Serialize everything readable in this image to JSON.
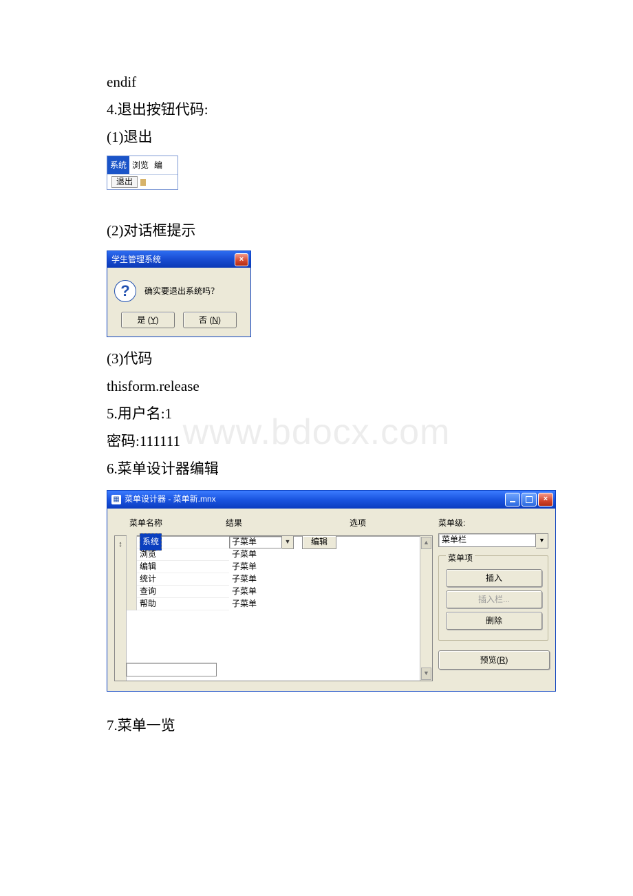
{
  "watermark": "www.bdocx.com",
  "text": {
    "endif": "endif",
    "s4": "4.退出按钮代码:",
    "s4_1": "(1)退出",
    "s4_2": "(2)对话框提示",
    "s4_3": "(3)代码",
    "code_release": "thisform.release",
    "s5": "5.用户名:1",
    "s5_pw": " 密码:111111",
    "s6": "6.菜单设计器编辑",
    "s7": "7.菜单一览"
  },
  "menu_strip": {
    "items": [
      "系统",
      "浏览",
      "编"
    ],
    "exit": "退出"
  },
  "dialog": {
    "title": "学生管理系统",
    "close": "×",
    "message": "确实要退出系统吗？",
    "yes": "是(Y)",
    "no": "否(N)",
    "yes_char": "Y",
    "no_char": "N",
    "yes_prefix": "是 (",
    "no_prefix": "否 (",
    "paren_close": ")"
  },
  "designer": {
    "title": "菜单设计器 - 菜单新.mnx",
    "close": "×",
    "col_name": "菜单名称",
    "col_result": "结果",
    "col_option": "选项",
    "level_label": "菜单级:",
    "level_value": "菜单栏",
    "items_label": "菜单项",
    "btn_insert": "插入",
    "btn_insertbar": "插入栏...",
    "btn_delete": "删除",
    "btn_preview_pre": "预览(",
    "btn_preview_u": "R",
    "btn_preview_post": ")",
    "edit_btn": "编辑",
    "sort_handle": "↕",
    "rows": [
      {
        "name": "系统",
        "result": "子菜单",
        "selected": true,
        "has_combo": true
      },
      {
        "name": "浏览",
        "result": "子菜单",
        "selected": false,
        "has_combo": false
      },
      {
        "name": "编辑",
        "result": "子菜单",
        "selected": false,
        "has_combo": false
      },
      {
        "name": "统计",
        "result": "子菜单",
        "selected": false,
        "has_combo": false
      },
      {
        "name": "查询",
        "result": "子菜单",
        "selected": false,
        "has_combo": false
      },
      {
        "name": "帮助",
        "result": "子菜单",
        "selected": false,
        "has_combo": false
      }
    ]
  }
}
